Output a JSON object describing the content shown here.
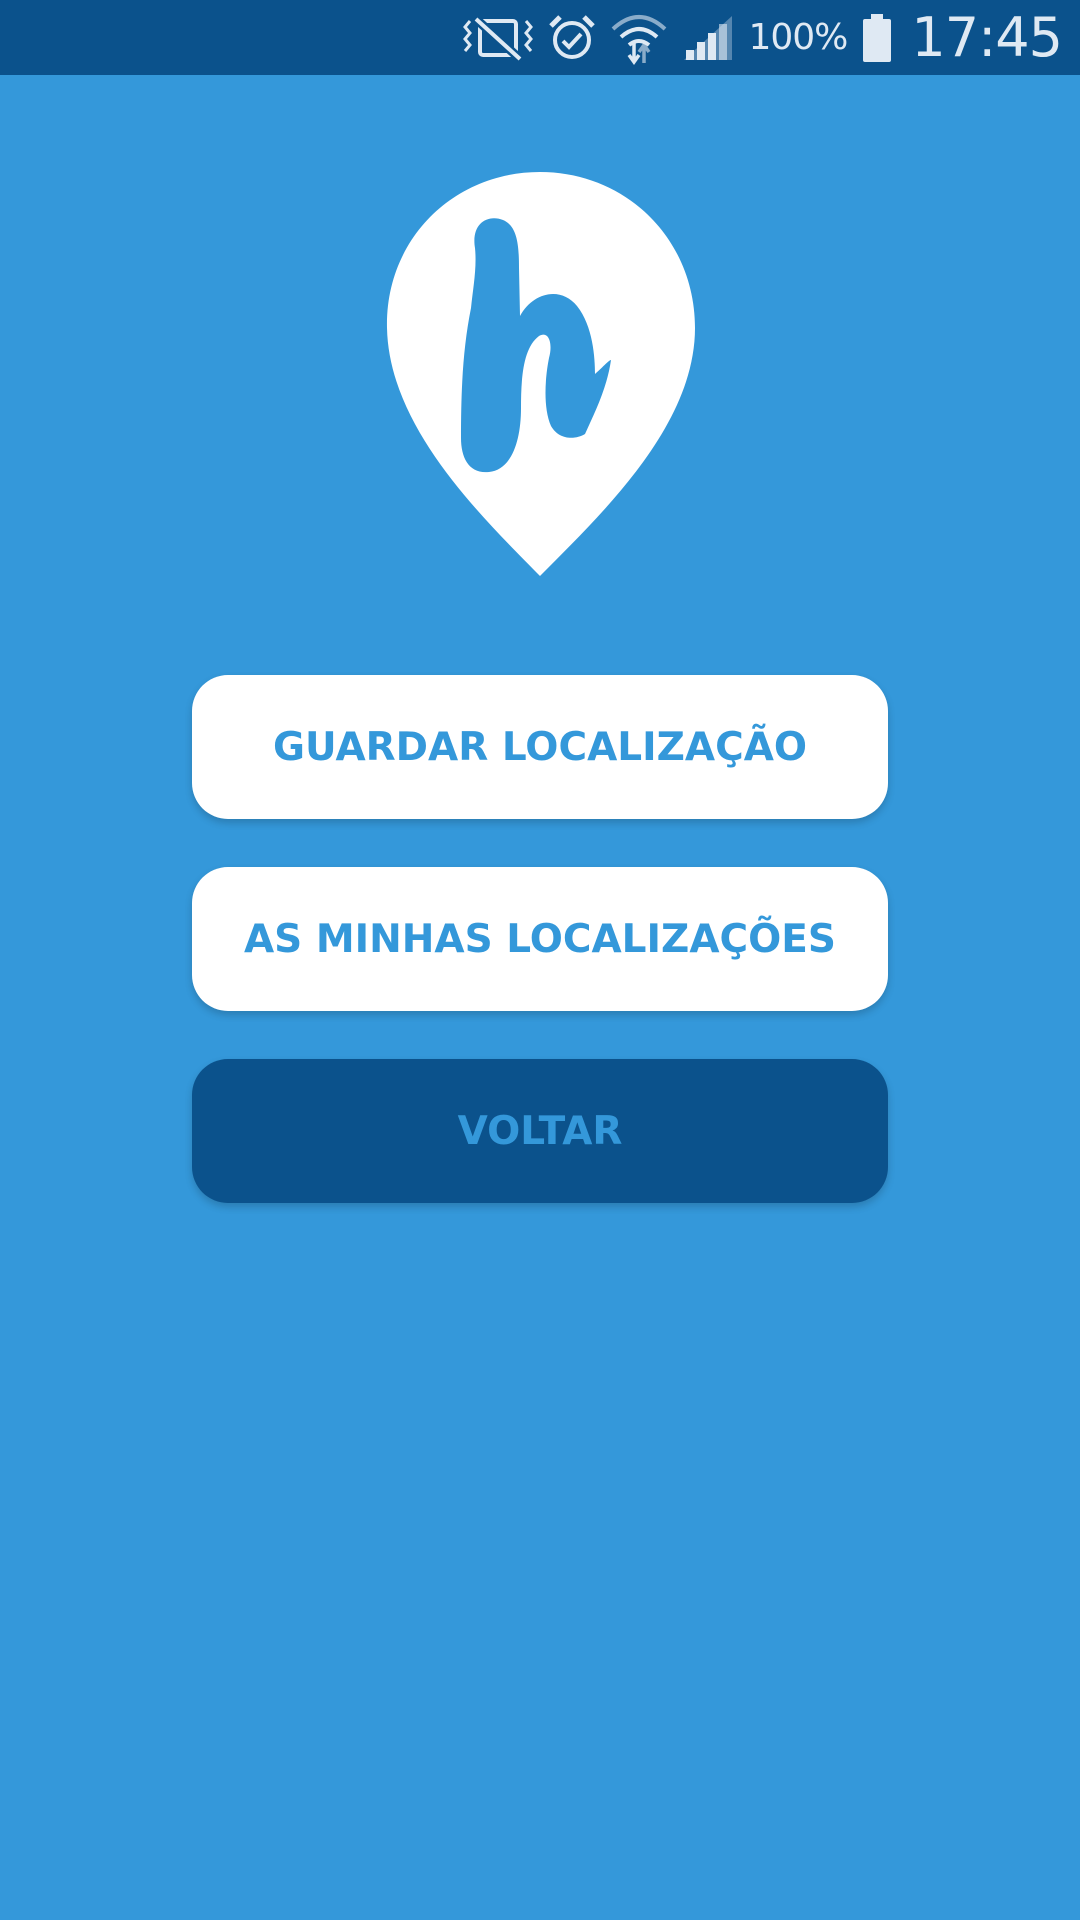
{
  "status_bar": {
    "battery_percent": "100%",
    "time": "17:45",
    "icons": [
      "vibrate-mute-icon",
      "alarm-icon",
      "wifi-icon",
      "signal-icon",
      "battery-icon"
    ]
  },
  "logo": {
    "icon": "location-pin-h-logo",
    "color": "#ffffff"
  },
  "actions": {
    "save_location_label": "GUARDAR LOCALIZAÇÃO",
    "my_locations_label": "AS MINHAS LOCALIZAÇÕES",
    "back_label": "VOLTAR"
  },
  "colors": {
    "background": "#3498da",
    "status_bar": "#0b528c",
    "primary_button": "#ffffff",
    "back_button": "#0b528c",
    "button_text": "#3498da"
  }
}
